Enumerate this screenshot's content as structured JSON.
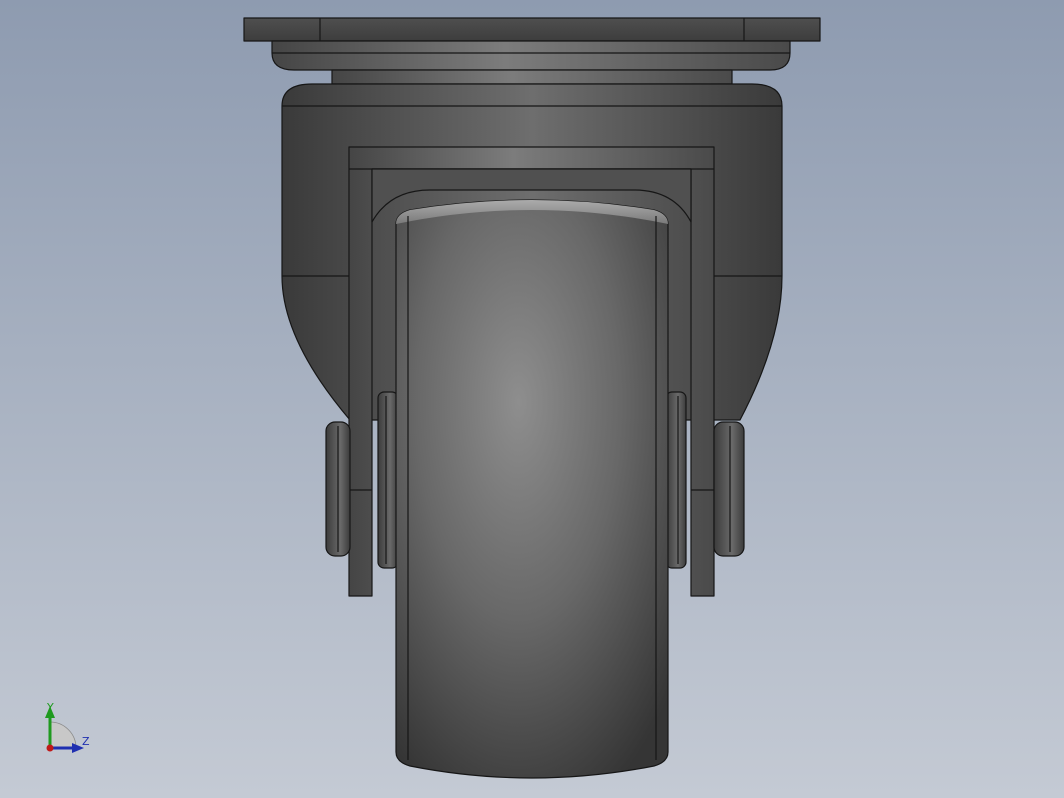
{
  "viewport": {
    "background_top": "#8e9bb0",
    "background_bottom": "#c4cad4",
    "part_colors": {
      "edge": "#1a1a1a",
      "dark": "#3c3c3c",
      "mid": "#6a6a6a",
      "light": "#a8a8a8"
    }
  },
  "triad": {
    "y_label": "Y",
    "z_label": "Z",
    "y_color": "#1f9a1f",
    "z_color": "#1f2fb0",
    "origin_color": "#c01818"
  }
}
